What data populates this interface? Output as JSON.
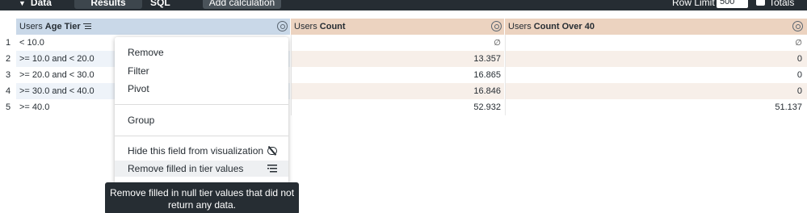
{
  "toolbar": {
    "data_label": "Data",
    "results_label": "Results",
    "sql_label": "SQL",
    "add_calc_label": "Add calculation",
    "row_limit_label": "Row Limit",
    "row_limit_value": "500",
    "totals_label": "Totals"
  },
  "columns": {
    "dim": {
      "prefix": "Users ",
      "name": "Age Tier"
    },
    "m1": {
      "prefix": "Users ",
      "name": "Count"
    },
    "m2": {
      "prefix": "Users ",
      "name": "Count Over 40"
    }
  },
  "rows": [
    {
      "num": "1",
      "tier": "< 10.0",
      "count": "∅",
      "over40": "∅"
    },
    {
      "num": "2",
      "tier": ">= 10.0 and < 20.0",
      "count": "13.357",
      "over40": "0"
    },
    {
      "num": "3",
      "tier": ">= 20.0 and < 30.0",
      "count": "16.865",
      "over40": "0"
    },
    {
      "num": "4",
      "tier": ">= 30.0 and < 40.0",
      "count": "16.846",
      "over40": "0"
    },
    {
      "num": "5",
      "tier": ">= 40.0",
      "count": "52.932",
      "over40": "51.137"
    }
  ],
  "menu": {
    "remove": "Remove",
    "filter": "Filter",
    "pivot": "Pivot",
    "group": "Group",
    "hide": "Hide this field from visualization",
    "remove_filled": "Remove filled in tier values"
  },
  "tooltip": {
    "line1": "Remove filled in null tier values that did not",
    "line2": "return any data."
  },
  "colors": {
    "toolbar_bg": "#262d33",
    "dimension_header": "#c9d8e8",
    "measure_header": "#ecd3c0"
  }
}
